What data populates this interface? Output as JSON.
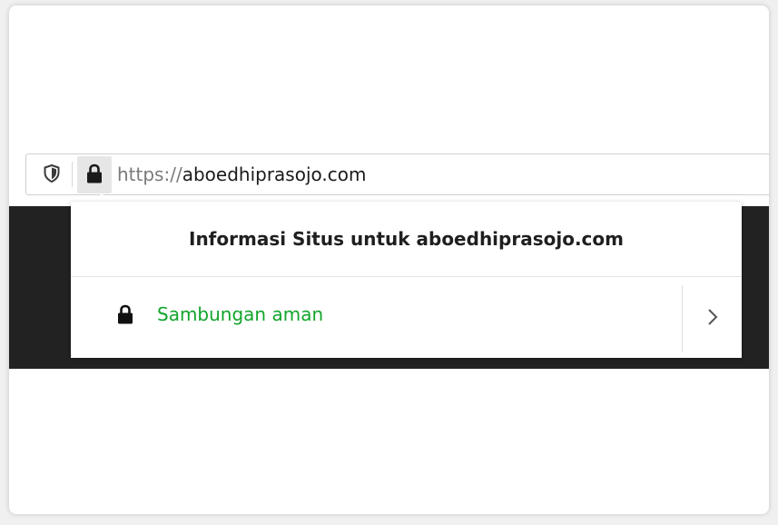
{
  "urlbar": {
    "scheme": "https://",
    "host": "aboedhiprasojo.com",
    "icons": {
      "tracking": "shield-icon",
      "identity": "lock-icon"
    }
  },
  "site_info_panel": {
    "title": "Informasi Situs untuk aboedhiprasojo.com",
    "connection": {
      "label": "Sambungan aman",
      "label_color": "#12a52b",
      "icon": "lock-icon",
      "more_icon": "chevron-right-icon"
    }
  },
  "colors": {
    "page_band": "#222222",
    "identity_button_bg": "#e6e6e6"
  }
}
